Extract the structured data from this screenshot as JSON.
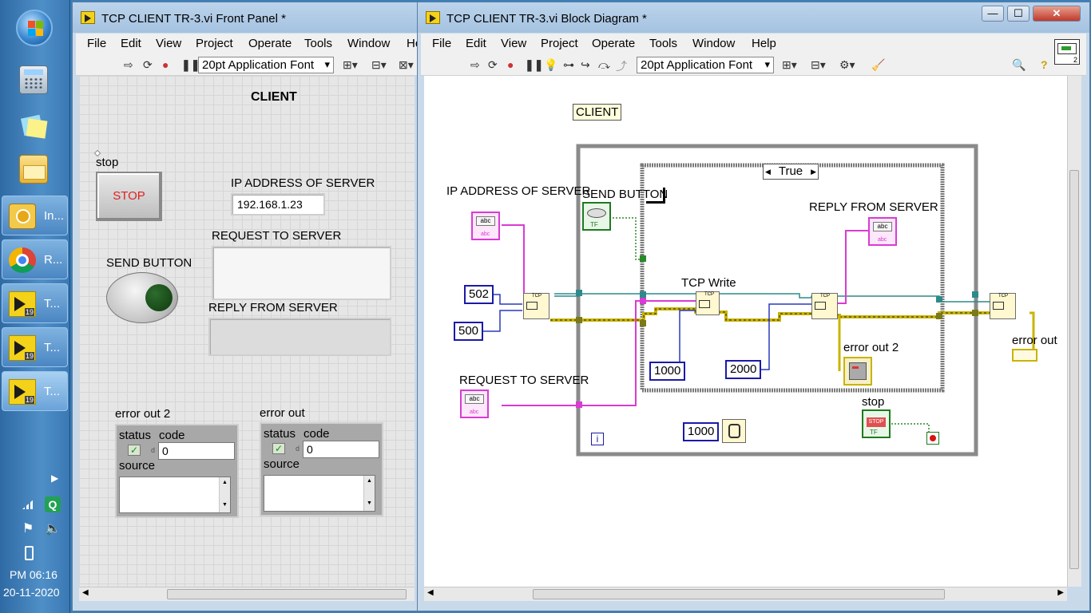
{
  "taskbar": {
    "tasks": [
      {
        "label": "In..."
      },
      {
        "label": "R..."
      },
      {
        "label": "T..."
      },
      {
        "label": "T..."
      },
      {
        "label": "T..."
      }
    ],
    "lv_version": "19",
    "clock": {
      "time": "PM 06:16",
      "date": "20-11-2020"
    }
  },
  "front_panel": {
    "title": "TCP CLIENT TR-3.vi Front Panel *",
    "menu": [
      "File",
      "Edit",
      "View",
      "Project",
      "Operate",
      "Tools",
      "Window",
      "He"
    ],
    "font": "20pt Application Font",
    "heading": "CLIENT",
    "stop_label": "stop",
    "stop_button": "STOP",
    "ip_label": "IP ADDRESS OF SERVER",
    "ip_value": "192.168.1.23",
    "request_label": "REQUEST TO SERVER",
    "request_value": "",
    "reply_label": "REPLY FROM SERVER",
    "reply_value": "",
    "send_label": "SEND BUTTON",
    "error2": {
      "label": "error out 2",
      "status": "status",
      "code": "code",
      "code_value": "0",
      "source": "source",
      "prefix": "d"
    },
    "error": {
      "label": "error out",
      "status": "status",
      "code": "code",
      "code_value": "0",
      "source": "source",
      "prefix": "d"
    }
  },
  "block_diagram": {
    "title": "TCP CLIENT TR-3.vi Block Diagram *",
    "menu": [
      "File",
      "Edit",
      "View",
      "Project",
      "Operate",
      "Tools",
      "Window",
      "Help"
    ],
    "font": "20pt Application Font",
    "comment": "CLIENT",
    "case_selector": "True",
    "labels": {
      "ip": "IP ADDRESS OF SERVER",
      "send": "SEND BUTTON",
      "reply": "REPLY FROM SERVER",
      "tcp_write": "TCP Write",
      "request": "REQUEST TO SERVER",
      "error_out2": "error out 2",
      "stop": "stop",
      "error_out": "error out"
    },
    "constants": {
      "port": "502",
      "open_timeout": "500",
      "write_timeout": "1000",
      "read_timeout": "2000",
      "wait_ms": "1000"
    },
    "loop_index": "i",
    "tf": "TF",
    "abc": "abc",
    "tcp": "TCP",
    "stop_glyph": "STOP",
    "icons": {
      "help": "?",
      "search": "search-icon"
    }
  }
}
